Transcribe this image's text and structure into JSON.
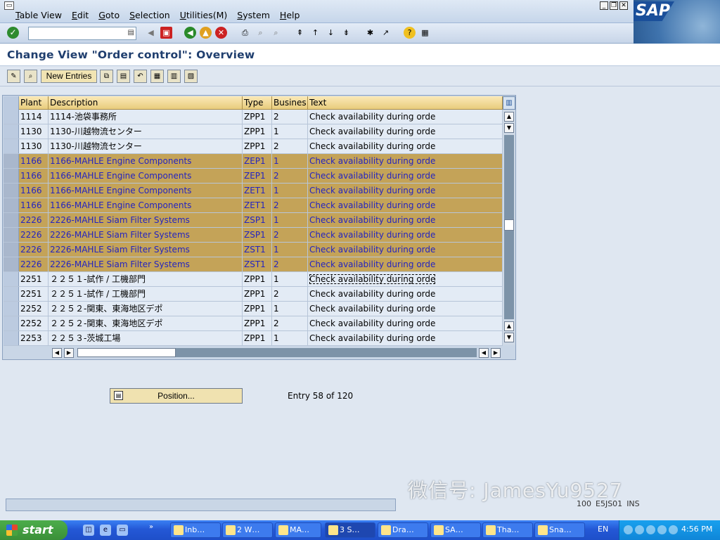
{
  "menubar": {
    "items": [
      "Table View",
      "Edit",
      "Goto",
      "Selection",
      "Utilities(M)",
      "System",
      "Help"
    ],
    "logo": "SAP"
  },
  "toolbar": {
    "command_field_value": ""
  },
  "screen": {
    "title": "Change View \"Order control\": Overview"
  },
  "app_toolbar": {
    "new_entries_label": "New Entries"
  },
  "table": {
    "columns": [
      "Plant",
      "Description",
      "Type",
      "Busines…",
      "Text"
    ],
    "rows": [
      {
        "plant": "1114",
        "description": "1114-池袋事務所",
        "type": "ZPP1",
        "business": "2",
        "text": "Check availability during orde",
        "selected": false
      },
      {
        "plant": "1130",
        "description": "1130-川越物流センター",
        "type": "ZPP1",
        "business": "1",
        "text": "Check availability during orde",
        "selected": false
      },
      {
        "plant": "1130",
        "description": "1130-川越物流センター",
        "type": "ZPP1",
        "business": "2",
        "text": "Check availability during orde",
        "selected": false
      },
      {
        "plant": "1166",
        "description": "1166-MAHLE Engine Components",
        "type": "ZEP1",
        "business": "1",
        "text": "Check availability during orde",
        "selected": true
      },
      {
        "plant": "1166",
        "description": "1166-MAHLE Engine Components",
        "type": "ZEP1",
        "business": "2",
        "text": "Check availability during orde",
        "selected": true
      },
      {
        "plant": "1166",
        "description": "1166-MAHLE Engine Components",
        "type": "ZET1",
        "business": "1",
        "text": "Check availability during orde",
        "selected": true
      },
      {
        "plant": "1166",
        "description": "1166-MAHLE Engine Components",
        "type": "ZET1",
        "business": "2",
        "text": "Check availability during orde",
        "selected": true
      },
      {
        "plant": "2226",
        "description": "2226-MAHLE Siam Filter Systems",
        "type": "ZSP1",
        "business": "1",
        "text": "Check availability during orde",
        "selected": true
      },
      {
        "plant": "2226",
        "description": "2226-MAHLE Siam Filter Systems",
        "type": "ZSP1",
        "business": "2",
        "text": "Check availability during orde",
        "selected": true
      },
      {
        "plant": "2226",
        "description": "2226-MAHLE Siam Filter Systems",
        "type": "ZST1",
        "business": "1",
        "text": "Check availability during orde",
        "selected": true
      },
      {
        "plant": "2226",
        "description": "2226-MAHLE Siam Filter Systems",
        "type": "ZST1",
        "business": "2",
        "text": "Check availability during orde",
        "selected": true
      },
      {
        "plant": "2251",
        "description": "２２５１-試作 / 工機部門",
        "type": "ZPP1",
        "business": "1",
        "text": "Check availability during orde",
        "selected": false,
        "focus": true
      },
      {
        "plant": "2251",
        "description": "２２５１-試作 / 工機部門",
        "type": "ZPP1",
        "business": "2",
        "text": "Check availability during orde",
        "selected": false
      },
      {
        "plant": "2252",
        "description": "２２５２-関東、東海地区デポ",
        "type": "ZPP1",
        "business": "1",
        "text": "Check availability during orde",
        "selected": false
      },
      {
        "plant": "2252",
        "description": "２２５２-関東、東海地区デポ",
        "type": "ZPP1",
        "business": "2",
        "text": "Check availability during orde",
        "selected": false
      },
      {
        "plant": "2253",
        "description": "２２５３-茨城工場",
        "type": "ZPP1",
        "business": "1",
        "text": "Check availability during orde",
        "selected": false
      }
    ]
  },
  "position_button_label": "Position...",
  "entry_info": "Entry 58 of 120",
  "status": {
    "client": "100",
    "server": "E5JS01",
    "mode": "INS"
  },
  "watermark": "微信号: JamesYu9527",
  "taskbar": {
    "start_label": "start",
    "tasks": [
      "Inb…",
      "2 W…",
      "MA…",
      "3 S…",
      "Dra…",
      "SA…",
      "Tha…",
      "Sna…"
    ],
    "language": "EN",
    "clock": "4:56 PM"
  },
  "colors": {
    "selected_row_bg": "#c4a358",
    "selected_row_text": "#2424c0",
    "header_bg": "#e8cc7d",
    "title_color": "#1f3e6e"
  }
}
